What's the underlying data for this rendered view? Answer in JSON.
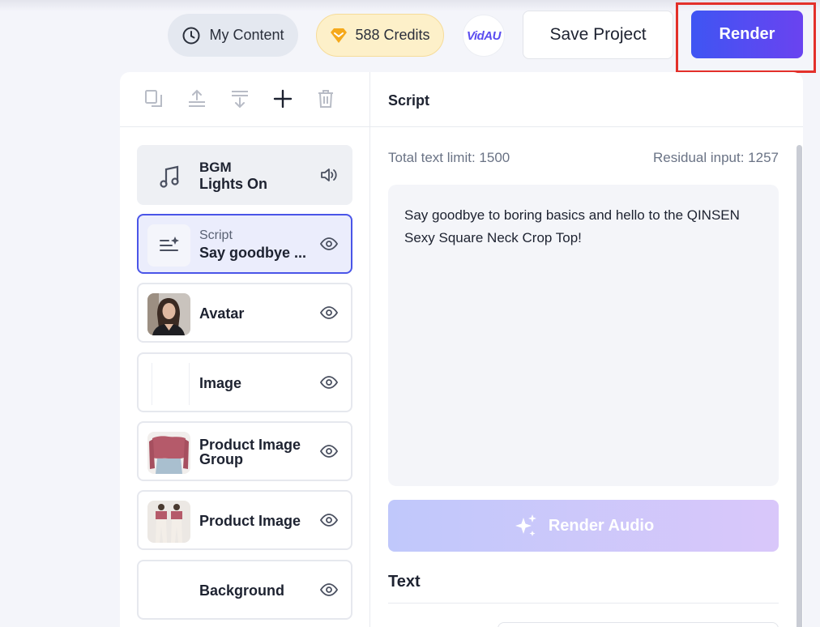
{
  "header": {
    "my_content_label": "My Content",
    "credits_label": "588 Credits",
    "logo_text": "VidAU",
    "save_label": "Save Project",
    "render_label": "Render"
  },
  "layers": {
    "bgm": {
      "label": "BGM",
      "name": "Lights On"
    },
    "script": {
      "label": "Script",
      "name": "Say goodbye ..."
    },
    "avatar": {
      "name": "Avatar"
    },
    "image": {
      "name": "Image"
    },
    "product_group": {
      "name_line1": "Product Image",
      "name_line2": "Group"
    },
    "product_image": {
      "name": "Product Image"
    },
    "background": {
      "name": "Background"
    }
  },
  "script_panel": {
    "title": "Script",
    "limit": "Total text limit: 1500",
    "residual": "Residual input: 1257",
    "text": "Say goodbye to boring basics and hello to the QINSEN Sexy Square Neck Crop Top!",
    "render_audio_label": "Render Audio",
    "text_section_title": "Text"
  },
  "colors": {
    "accent": "#4a55e8",
    "render_gradient_start": "#3f55f3",
    "render_gradient_end": "#6a43f0",
    "highlight": "#e3302a"
  }
}
